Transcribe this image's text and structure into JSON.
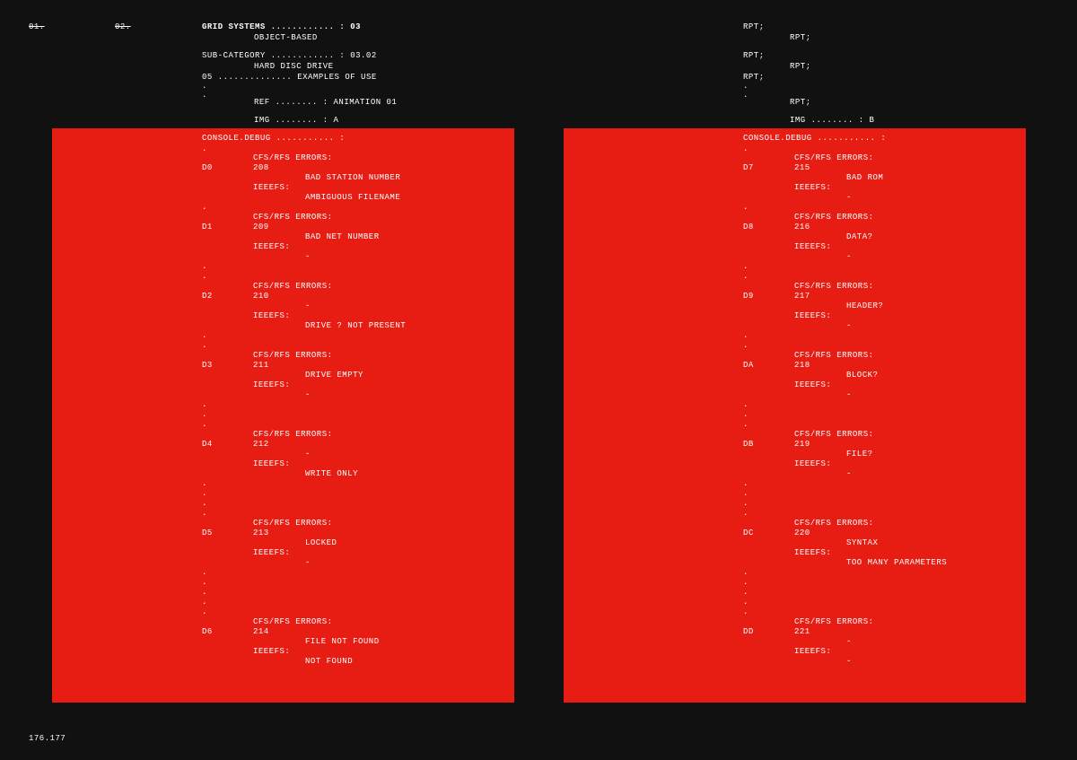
{
  "nav": {
    "one": "01.",
    "two": "02."
  },
  "header": {
    "title_label": "GRID SYSTEMS",
    "title_num": "03",
    "title_sub": "OBJECT-BASED",
    "subcat_label": "SUB-CATEGORY",
    "subcat_num": "03.02",
    "subcat_name": "HARD DISC DRIVE",
    "examples_num": "05",
    "examples_label": "EXAMPLES OF USE",
    "ref_label": "REF",
    "ref_value": "ANIMATION 01",
    "img_label": "IMG",
    "img_a": "A",
    "img_b": "B",
    "console": "CONSOLE.DEBUG",
    "rpt": "RPT;"
  },
  "labels": {
    "cfs": "CFS/RFS ERRORS:",
    "ieeefs": "IEEEFS:",
    "dash": "-",
    "dot": "."
  },
  "left_errors": [
    {
      "code": "D0",
      "num": "208",
      "cfs_msg": "BAD STATION NUMBER",
      "ieee_msg": "AMBIGUOUS FILENAME",
      "pre_dots": 0
    },
    {
      "code": "D1",
      "num": "209",
      "cfs_msg": "BAD NET NUMBER",
      "ieee_msg": "-",
      "pre_dots": 1
    },
    {
      "code": "D2",
      "num": "210",
      "cfs_msg": "-",
      "ieee_msg": "DRIVE ? NOT PRESENT",
      "pre_dots": 2
    },
    {
      "code": "D3",
      "num": "211",
      "cfs_msg": "DRIVE EMPTY",
      "ieee_msg": "-",
      "pre_dots": 2
    },
    {
      "code": "D4",
      "num": "212",
      "cfs_msg": "-",
      "ieee_msg": "WRITE ONLY",
      "pre_dots": 3
    },
    {
      "code": "D5",
      "num": "213",
      "cfs_msg": "LOCKED",
      "ieee_msg": "-",
      "pre_dots": 4
    },
    {
      "code": "D6",
      "num": "214",
      "cfs_msg": "FILE NOT FOUND",
      "ieee_msg": "NOT FOUND",
      "pre_dots": 5
    }
  ],
  "right_errors": [
    {
      "code": "D7",
      "num": "215",
      "cfs_msg": "BAD ROM",
      "ieee_msg": "-",
      "pre_dots": 0
    },
    {
      "code": "D8",
      "num": "216",
      "cfs_msg": "DATA?",
      "ieee_msg": "-",
      "pre_dots": 1
    },
    {
      "code": "D9",
      "num": "217",
      "cfs_msg": "HEADER?",
      "ieee_msg": "-",
      "pre_dots": 2
    },
    {
      "code": "DA",
      "num": "218",
      "cfs_msg": "BLOCK?",
      "ieee_msg": "-",
      "pre_dots": 2
    },
    {
      "code": "DB",
      "num": "219",
      "cfs_msg": "FILE?",
      "ieee_msg": "-",
      "pre_dots": 3
    },
    {
      "code": "DC",
      "num": "220",
      "cfs_msg": "SYNTAX",
      "ieee_msg": "TOO MANY PARAMETERS",
      "pre_dots": 4
    },
    {
      "code": "DD",
      "num": "221",
      "cfs_msg": "-",
      "ieee_msg": "-",
      "pre_dots": 5
    }
  ],
  "footer": "176.177"
}
